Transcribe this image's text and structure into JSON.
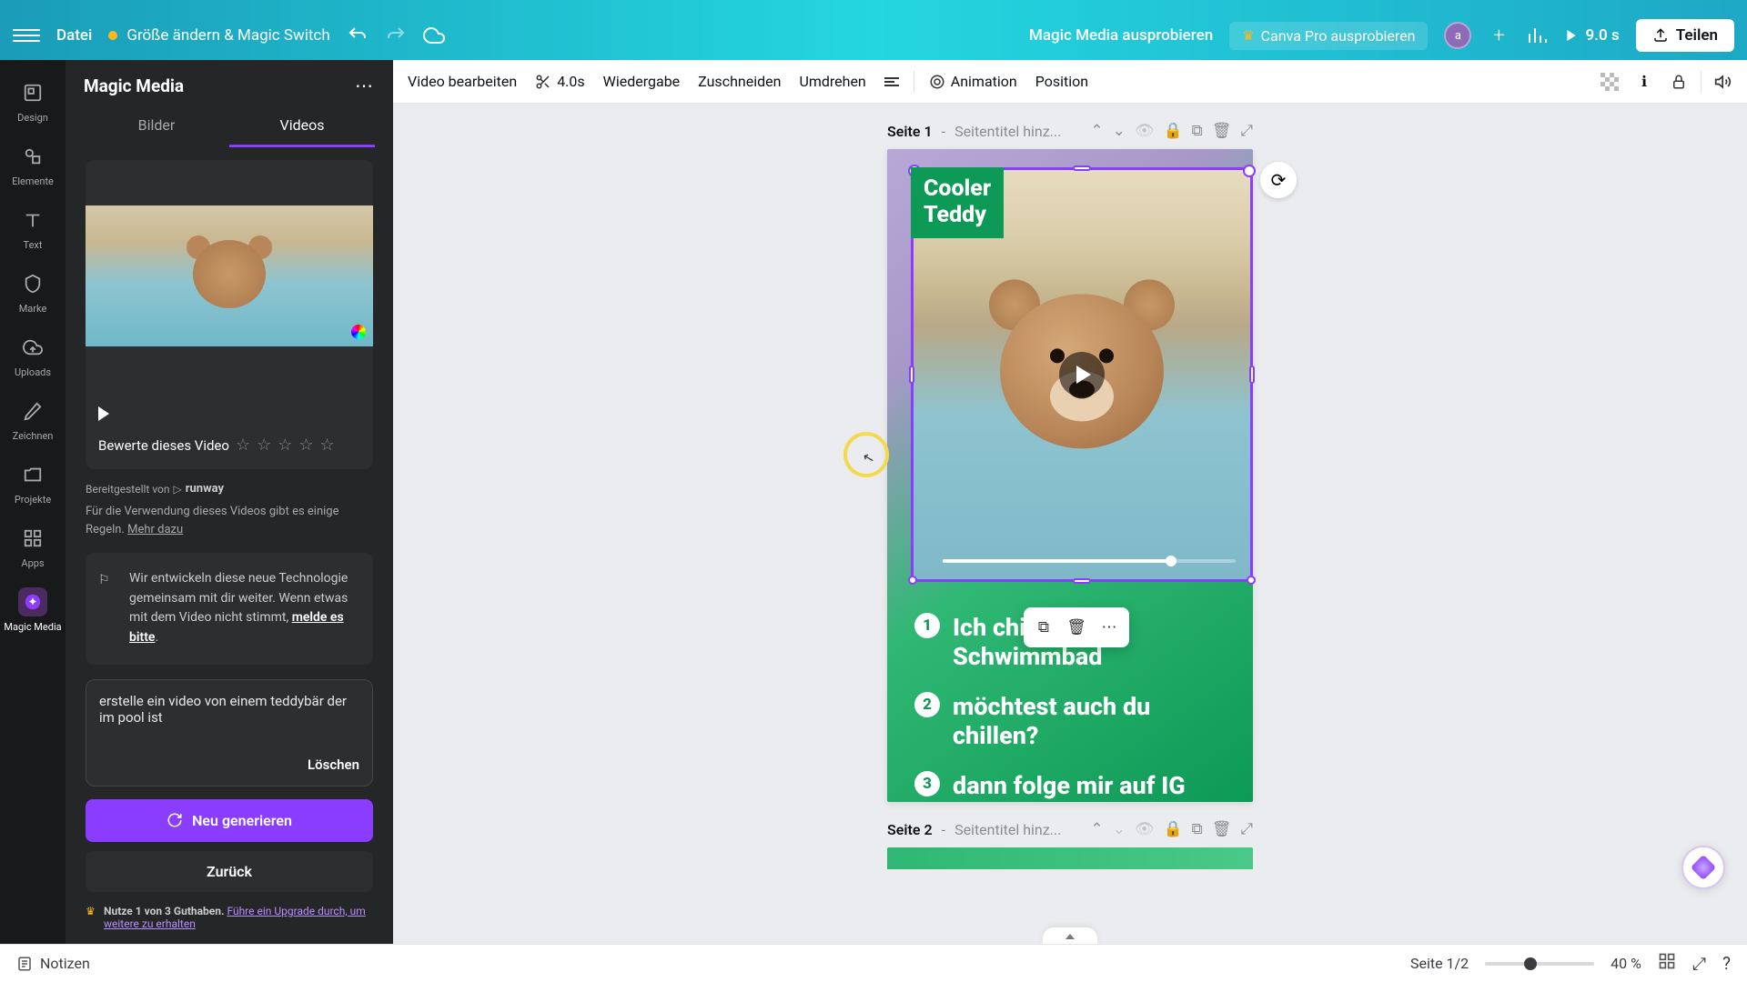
{
  "header": {
    "file": "Datei",
    "magic_switch": "Größe ändern & Magic Switch",
    "magic_media_try": "Magic Media ausprobieren",
    "pro_try": "Canva Pro ausprobieren",
    "avatar_initial": "a",
    "duration": "9.0 s",
    "share": "Teilen"
  },
  "rail": {
    "design": "Design",
    "elements": "Elemente",
    "text": "Text",
    "brand": "Marke",
    "uploads": "Uploads",
    "draw": "Zeichnen",
    "projects": "Projekte",
    "apps": "Apps",
    "magic_media": "Magic Media"
  },
  "panel": {
    "title": "Magic Media",
    "tab_images": "Bilder",
    "tab_videos": "Videos",
    "rate_label": "Bewerte dieses Video",
    "provider_prefix": "Bereitgestellt von",
    "provider_name": "runway",
    "usage_text": "Für die Verwendung dieses Videos gibt es einige Regeln.",
    "usage_link": "Mehr dazu",
    "feedback": "Wir entwickeln diese neue Technologie gemeinsam mit dir weiter. Wenn etwas mit dem Video nicht stimmt, ",
    "feedback_link": "melde es bitte",
    "prompt": "erstelle ein video von einem teddybär der im pool ist",
    "clear": "Löschen",
    "generate": "Neu generieren",
    "back": "Zurück",
    "credits_bold": "Nutze 1 von 3 Guthaben.",
    "credits_link": "Führe ein Upgrade durch, um weitere zu erhalten"
  },
  "toolbar": {
    "edit_video": "Video bearbeiten",
    "clip_duration": "4.0s",
    "playback": "Wiedergabe",
    "crop": "Zuschneiden",
    "flip": "Umdrehen",
    "animation": "Animation",
    "position": "Position"
  },
  "page1": {
    "label": "Seite 1",
    "sep": " - ",
    "placeholder": "Seitentitel hinz...",
    "title_line1": "Cooler",
    "title_line2": "Teddy",
    "item1": "Ich chil",
    "item1b": "Schwimmbad",
    "item2": "möchtest auch du chillen?",
    "item3": "dann folge mir auf IG",
    "n1": "1",
    "n2": "2",
    "n3": "3"
  },
  "page2": {
    "label": "Seite 2",
    "sep": " - ",
    "placeholder": "Seitentitel hinz..."
  },
  "footer": {
    "notes": "Notizen",
    "page_indicator": "Seite 1/2",
    "zoom": "40 %"
  }
}
